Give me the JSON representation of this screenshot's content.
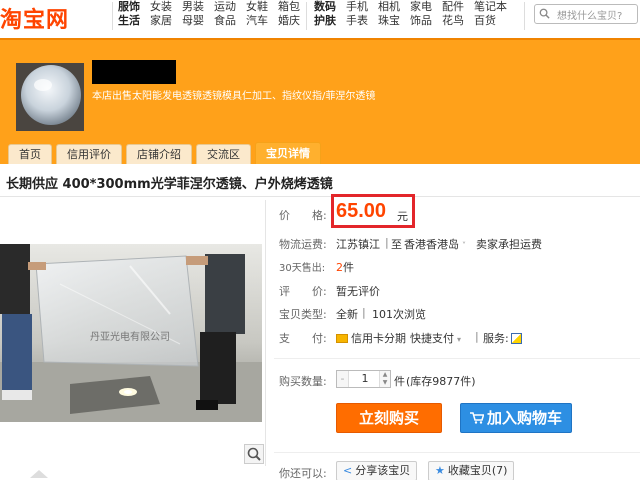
{
  "header": {
    "logo_text": "淘宝网",
    "categories_left": [
      {
        "label": "服饰",
        "bold": true
      },
      {
        "label": "女装"
      },
      {
        "label": "男装"
      },
      {
        "label": "运动"
      },
      {
        "label": "女鞋"
      },
      {
        "label": "箱包"
      },
      {
        "label": "生活",
        "bold": true
      },
      {
        "label": "家居"
      },
      {
        "label": "母婴"
      },
      {
        "label": "食品"
      },
      {
        "label": "汽车"
      },
      {
        "label": "婚庆"
      }
    ],
    "categories_right": [
      {
        "label": "数码",
        "bold": true
      },
      {
        "label": "手机"
      },
      {
        "label": "相机"
      },
      {
        "label": "家电"
      },
      {
        "label": "配件"
      },
      {
        "label": "笔记本"
      },
      {
        "label": "护肤",
        "bold": true
      },
      {
        "label": "手表"
      },
      {
        "label": "珠宝"
      },
      {
        "label": "饰品"
      },
      {
        "label": "花鸟"
      },
      {
        "label": "百货"
      }
    ],
    "search_placeholder": "想找什么宝贝?"
  },
  "shop": {
    "description": "本店出售太阳能发电透镜透镜模具仁加工、指纹仪指/菲涅尔透镜",
    "tabs": [
      {
        "label": "首页",
        "active": false
      },
      {
        "label": "信用评价",
        "active": false
      },
      {
        "label": "店铺介绍",
        "active": false
      },
      {
        "label": "交流区",
        "active": false
      },
      {
        "label": "宝贝详情",
        "active": true
      }
    ]
  },
  "product": {
    "title": "长期供应 400*300mm光学菲涅尔透镜、户外烧烤透镜",
    "photo_watermark": "丹亚光电有限公司",
    "price_label": "价　　格:",
    "price": "65.00",
    "price_unit": "元",
    "shipping_label": "物流运费:",
    "shipping_from": "江苏镇江",
    "shipping_sep": "|",
    "shipping_to_prefix": "至",
    "shipping_to": "香港香港岛",
    "shipping_fee": "卖家承担运费",
    "sold_label": "30天售出:",
    "sold_count": "2",
    "sold_unit": "件",
    "review_label": "评　　价:",
    "review_value": "暂无评价",
    "type_label": "宝贝类型:",
    "type_value": "全新",
    "views": "101次浏览",
    "pay_label": "支　　付:",
    "pay_credit": "信用卡分期",
    "pay_quick": "快捷支付",
    "service_label": "服务:",
    "qty_label": "购买数量:",
    "qty_minus": "-",
    "qty_value": "1",
    "qty_unit": "件",
    "stock": "(库存9877件)",
    "buy_now": "立刻购买",
    "add_cart": "加入购物车",
    "also_label": "你还可以:",
    "share": "分享该宝贝",
    "favorite": "收藏宝贝(7)"
  },
  "colors": {
    "brand_orange": "#ff4400",
    "banner": "#ffa11a",
    "buy_button": "#ff6d00",
    "cart_button": "#2d8fe3",
    "price_highlight_border": "#e3262a"
  },
  "icons": [
    "search-icon",
    "zoom-icon",
    "credit-card-icon",
    "service-icon",
    "cart-icon",
    "share-icon",
    "star-icon"
  ]
}
